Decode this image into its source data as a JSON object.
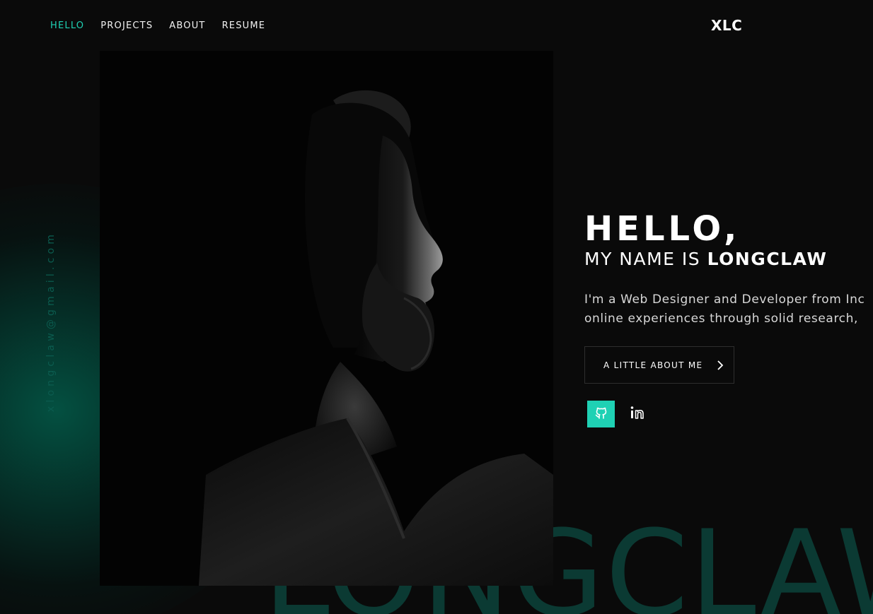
{
  "nav": {
    "items": [
      {
        "label": "HELLO",
        "active": true
      },
      {
        "label": "PROJECTS",
        "active": false
      },
      {
        "label": "ABOUT",
        "active": false
      },
      {
        "label": "RESUME",
        "active": false
      }
    ]
  },
  "brand": {
    "logo": "XLC"
  },
  "sidebar": {
    "email": "xlongclaw@gmail.com"
  },
  "hero": {
    "greeting": "HELLO,",
    "name_prefix": "MY NAME IS ",
    "name": "LONGCLAW",
    "bio_lines": [
      "I'm a Web Designer and Developer from Inc",
      "online experiences through solid research,"
    ],
    "cta_label": "A LITTLE ABOUT ME",
    "cta_icon": "chevron-right-icon"
  },
  "social": [
    {
      "name": "github",
      "icon": "github-icon",
      "active": true
    },
    {
      "name": "linkedin",
      "icon": "linkedin-icon",
      "active": false
    }
  ],
  "background_text": "LONGCLAW",
  "photo": {
    "subject": "portrait-photo"
  },
  "colors": {
    "accent": "#1fd1b4",
    "background": "#0a0a0a",
    "muted_teal": "#0b5c4f",
    "background_word": "#0b3a33"
  }
}
